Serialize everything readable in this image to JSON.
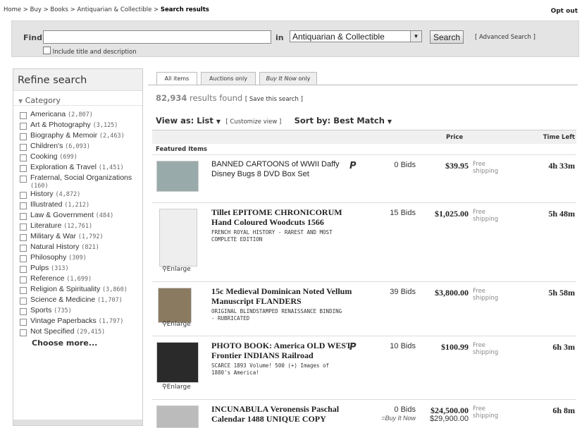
{
  "breadcrumb": {
    "trail": "Home > Buy > Books > Antiquarian & Collectible >",
    "current": "Search results"
  },
  "opt_out": "Opt out",
  "find": {
    "label": "Find",
    "value": "",
    "include_label": "Include title and description",
    "in_label": "in",
    "category_selected": "Antiquarian & Collectible",
    "search_button": "Search",
    "advanced": "[ Advanced Search ]"
  },
  "sidebar": {
    "title": "Refine search",
    "category_heading": "Category",
    "items": [
      {
        "name": "Americana",
        "count": "(2,807)"
      },
      {
        "name": "Art & Photography",
        "count": "(3,125)"
      },
      {
        "name": "Biography & Memoir",
        "count": "(2,463)"
      },
      {
        "name": "Children's",
        "count": "(6,093)"
      },
      {
        "name": "Cooking",
        "count": "(699)"
      },
      {
        "name": "Exploration & Travel",
        "count": "(1,451)"
      },
      {
        "name": "Fraternal, Social Organizations",
        "count": "(160)"
      },
      {
        "name": "History",
        "count": "(4,872)"
      },
      {
        "name": "Illustrated",
        "count": "(1,212)"
      },
      {
        "name": "Law & Government",
        "count": "(484)"
      },
      {
        "name": "Literature",
        "count": "(12,761)"
      },
      {
        "name": "Military & War",
        "count": "(1,792)"
      },
      {
        "name": "Natural History",
        "count": "(821)"
      },
      {
        "name": "Philosophy",
        "count": "(309)"
      },
      {
        "name": "Pulps",
        "count": "(313)"
      },
      {
        "name": "Reference",
        "count": "(1,699)"
      },
      {
        "name": "Religion & Spirituality",
        "count": "(3,860)"
      },
      {
        "name": "Science & Medicine",
        "count": "(1,707)"
      },
      {
        "name": "Sports",
        "count": "(735)"
      },
      {
        "name": "Vintage Paperbacks",
        "count": "(1,797)"
      },
      {
        "name": "Not Specified",
        "count": "(29,415)"
      }
    ],
    "choose_more": "Choose more..."
  },
  "tabs": [
    "All items",
    "Auctions only",
    "Buy It Now",
    "only"
  ],
  "results": {
    "count": "82,934",
    "label": "results found",
    "save": "[ Save this search ]"
  },
  "view": {
    "view_as": "View as: List",
    "customize": "[ Customize view ]",
    "sort_by": "Sort by: Best Match"
  },
  "table": {
    "price_header": "Price",
    "time_header": "Time Left",
    "featured_label": "Featured Items",
    "enlarge": "Enlarge",
    "free_shipping": "Free shipping",
    "rows": [
      {
        "title": "BANNED CARTOONS of WWII Daffy Disney Bugs 8 DVD Box Set",
        "subtitle": "",
        "paypal": true,
        "bids": "0 Bids",
        "price": "$39.95",
        "time": "4h 33m",
        "bin": "",
        "bin_price": ""
      },
      {
        "title": "Tillet EPITOME CHRONICORUM Hand Coloured Woodcuts 1566",
        "subtitle": "FRENCH ROYAL HISTORY - RAREST AND MOST COMPLETE EDITION",
        "paypal": false,
        "bids": "15 Bids",
        "price": "$1,025.00",
        "time": "5h 48m",
        "bin": "",
        "bin_price": ""
      },
      {
        "title": "15c Medieval Dominican Noted Vellum Manuscript FLANDERS",
        "subtitle": "ORIGINAL BLINDSTAMPED RENAISSANCE BINDING - RUBRICATED",
        "paypal": false,
        "bids": "39 Bids",
        "price": "$3,800.00",
        "time": "5h 58m",
        "bin": "",
        "bin_price": ""
      },
      {
        "title": "PHOTO BOOK: America OLD WEST Frontier INDIANS Railroad",
        "subtitle": "SCARCE 1893 Volume! 500 (+) Images of 1880's America!",
        "paypal": true,
        "bids": "10 Bids",
        "price": "$100.99",
        "time": "6h 3m",
        "bin": "",
        "bin_price": ""
      },
      {
        "title": "INCUNABULA Veronensis Paschal Calendar 1488 UNIQUE COPY",
        "subtitle": "",
        "paypal": false,
        "bids": "0 Bids",
        "price": "$24,500.00",
        "time": "6h 8m",
        "bin": "=Buy It Now",
        "bin_price": "$29,900.00"
      }
    ]
  },
  "paypal_mark": "P"
}
